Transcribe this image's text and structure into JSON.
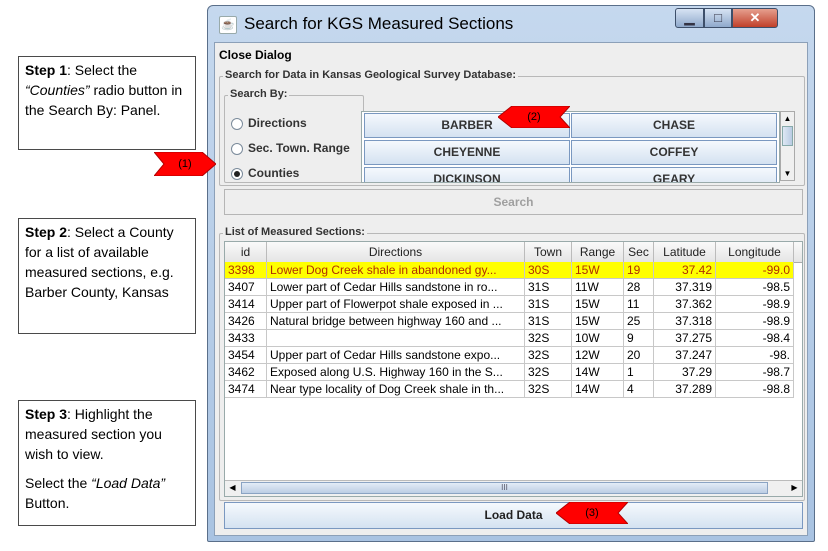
{
  "steps": {
    "step1": {
      "label": "Step 1",
      "text_a": ": Select the ",
      "italic": "“Counties”",
      "text_b": " radio button in the Search By: Panel."
    },
    "step2": {
      "label": "Step 2",
      "text": ": Select a County for a list of available measured sections, e.g. Barber County, Kansas"
    },
    "step3": {
      "label": "Step 3",
      "text": ": Highlight the measured section you wish to view.",
      "text2_a": "Select the ",
      "italic": "“Load Data”",
      "text2_b": " Button."
    }
  },
  "callouts": {
    "one": "(1)",
    "two": "(2)",
    "three": "(3)"
  },
  "window": {
    "title": "Search for KGS Measured Sections",
    "menu": "Close Dialog",
    "db_group_label": "Search for Data in Kansas Geological Survey Database:",
    "searchby_label": "Search By:",
    "radios": [
      "Directions",
      "Sec. Town. Range",
      "Counties"
    ],
    "selected_radio": "Counties",
    "counties": [
      "BARBER",
      "CHASE",
      "CHEYENNE",
      "COFFEY",
      "DICKINSON",
      "GEARY"
    ],
    "search_button": "Search",
    "list_label": "List of Measured Sections:",
    "load_button": "Load Data",
    "scroll_grip": "III"
  },
  "table": {
    "columns": [
      "id",
      "Directions",
      "Town",
      "Range",
      "Sec",
      "Latitude",
      "Longitude"
    ],
    "rows": [
      [
        "3398",
        "Lower Dog Creek shale in abandoned gy...",
        "30S",
        "15W",
        "19",
        "37.42",
        "-99.0"
      ],
      [
        "3407",
        "Lower part of Cedar Hills sandstone in ro...",
        "31S",
        "11W",
        "28",
        "37.319",
        "-98.5"
      ],
      [
        "3414",
        "Upper part of Flowerpot shale exposed in ...",
        "31S",
        "15W",
        "11",
        "37.362",
        "-98.9"
      ],
      [
        "3426",
        "Natural bridge between highway 160 and ...",
        "31S",
        "15W",
        "25",
        "37.318",
        "-98.9"
      ],
      [
        "3433",
        "",
        "32S",
        "10W",
        "9",
        "37.275",
        "-98.4"
      ],
      [
        "3454",
        "Upper part of Cedar Hills sandstone expo...",
        "32S",
        "12W",
        "20",
        "37.247",
        "-98."
      ],
      [
        "3462",
        "Exposed along U.S. Highway 160 in the S...",
        "32S",
        "14W",
        "1",
        "37.29",
        "-98.7"
      ],
      [
        "3474",
        "Near type locality of Dog Creek shale in th...",
        "32S",
        "14W",
        "4",
        "37.289",
        "-98.8"
      ]
    ],
    "selected_row": 0
  },
  "colors": {
    "highlight": "#ffff00",
    "callout": "#ff0000"
  }
}
